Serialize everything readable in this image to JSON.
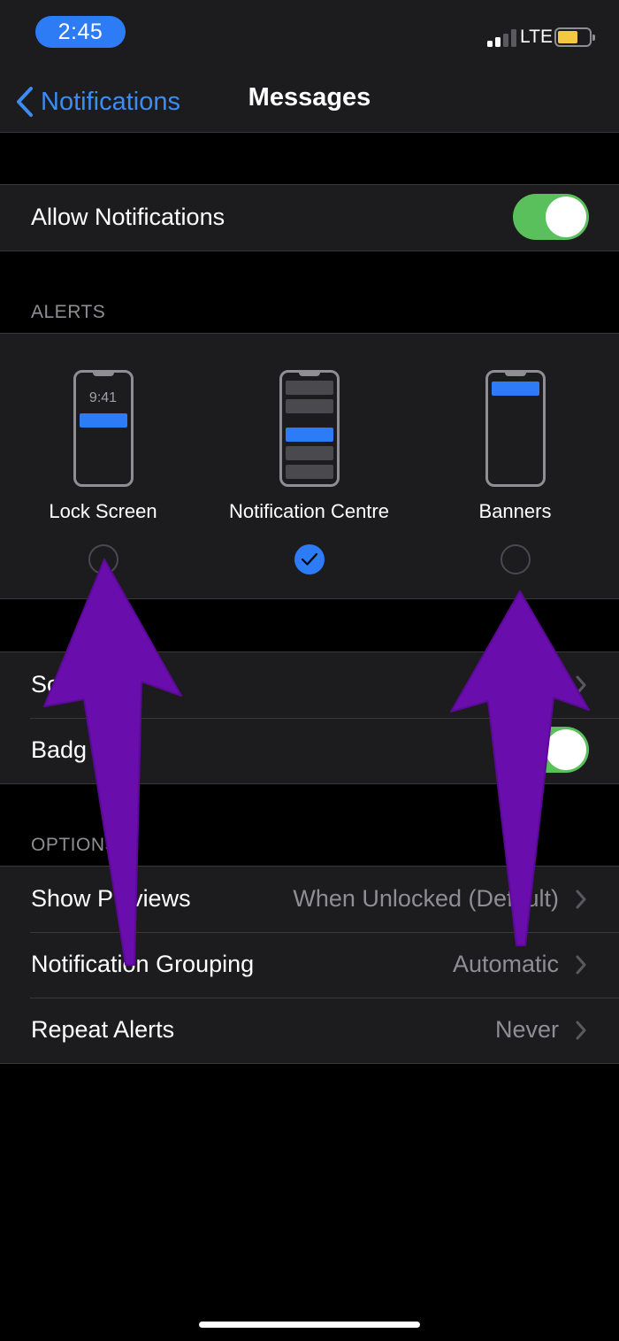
{
  "status_bar": {
    "time": "2:45",
    "carrier": "LTE",
    "signal_bars": 4,
    "signal_bars_active": 2,
    "battery_level": 0.6,
    "battery_color": "#f5c842",
    "accent_color": "#2d7cf6"
  },
  "nav": {
    "back_label": "Notifications",
    "title": "Messages"
  },
  "allow_notifications": {
    "label": "Allow Notifications",
    "on": true
  },
  "alerts": {
    "header": "ALERTS",
    "options": [
      {
        "label": "Lock Screen",
        "preview_time": "9:41",
        "checked": false
      },
      {
        "label": "Notification Centre",
        "checked": true
      },
      {
        "label": "Banners",
        "checked": false
      }
    ]
  },
  "sounds_badges": {
    "sounds_label": "So",
    "badges_label": "Badg",
    "badges_on": true
  },
  "options": {
    "header": "OPTIONS",
    "rows": [
      {
        "label": "Show P",
        "label_end": "views",
        "value": "When Unlocked (Def",
        "value_end": "ult)"
      },
      {
        "label": "Notification Grouping",
        "value": "Automatic"
      },
      {
        "label": "Repeat Alerts",
        "value": "Never"
      }
    ]
  },
  "annotation": {
    "arrow_color": "#6a0dad",
    "arrow_count": 2
  }
}
